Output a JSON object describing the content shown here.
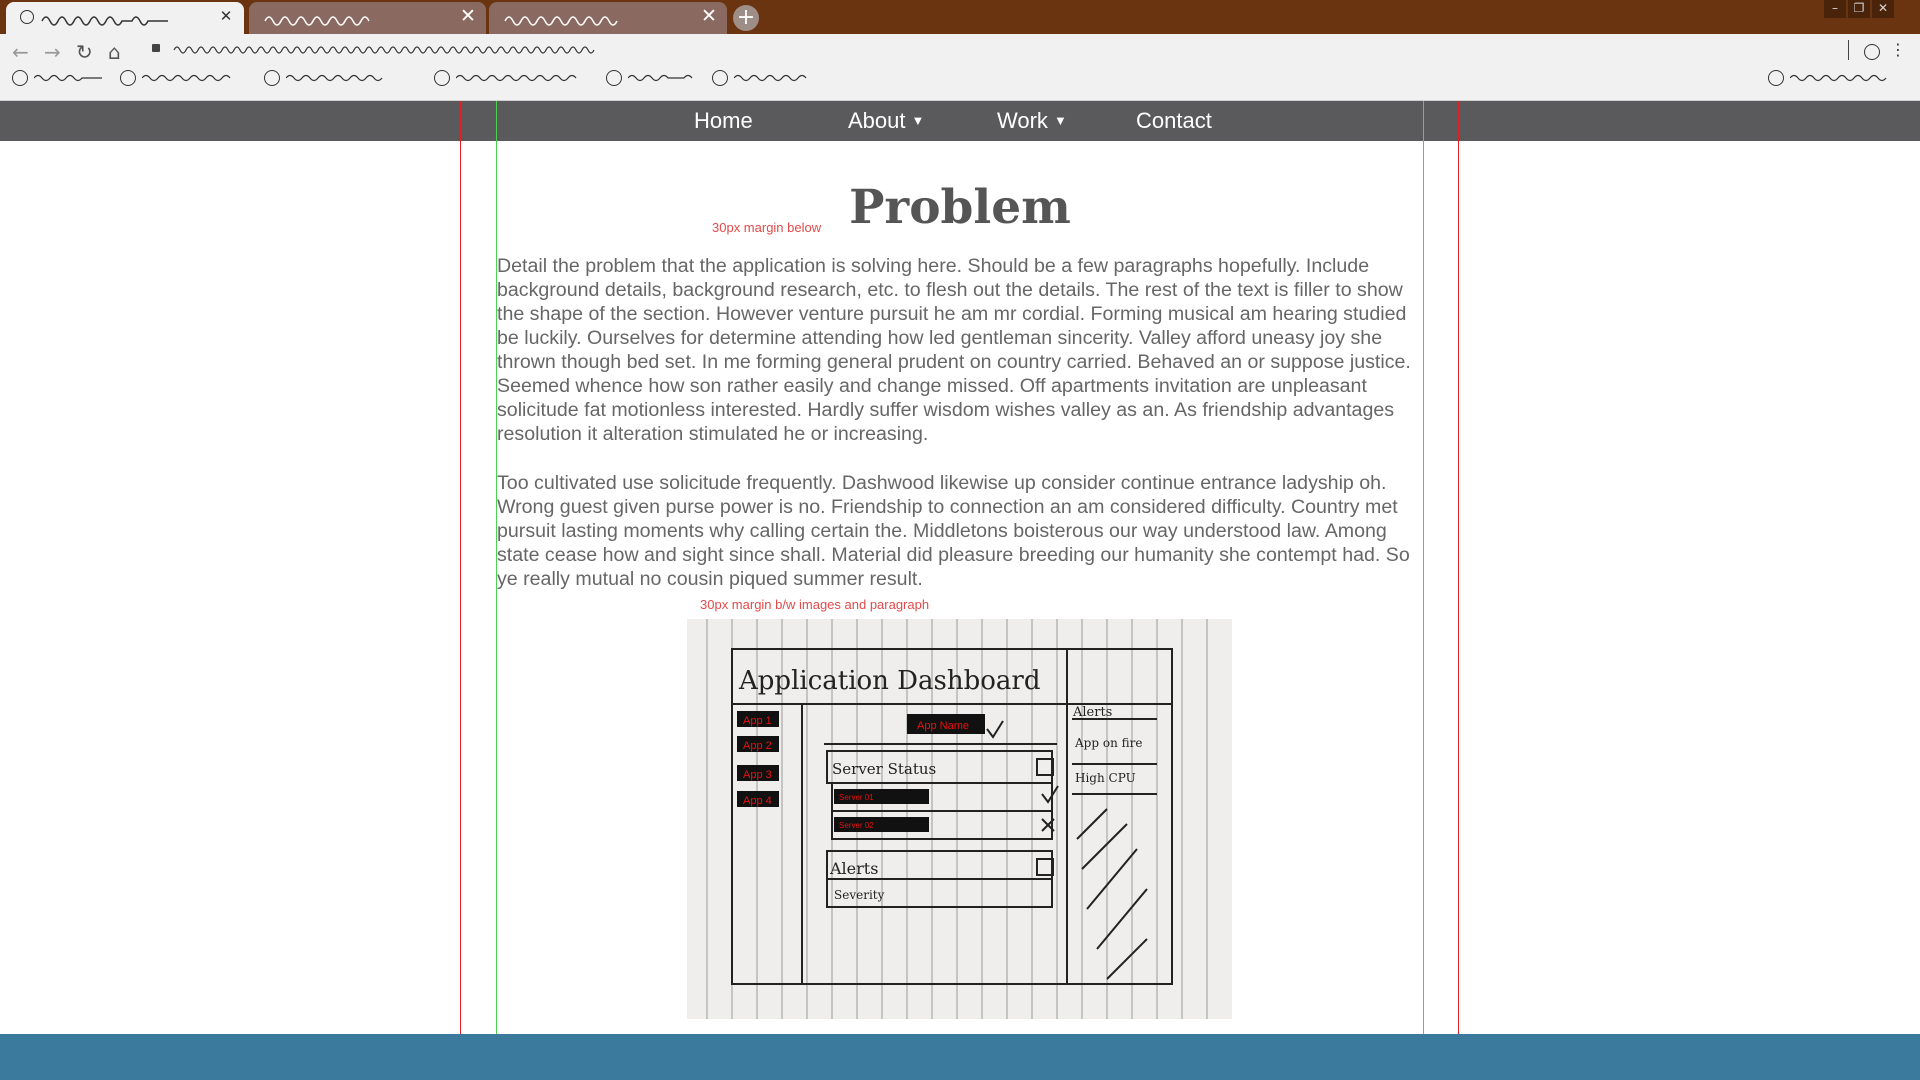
{
  "browser": {
    "tabs": [
      {
        "label": "",
        "active": true
      },
      {
        "label": "",
        "active": false
      },
      {
        "label": "",
        "active": false
      }
    ],
    "new_tab_label": "+",
    "close_glyph": "✕",
    "address": "",
    "icons": [
      "back-icon",
      "forward-icon",
      "reload-icon",
      "home-icon",
      "lock-icon",
      "profile-icon",
      "menu-icon",
      "minimize-icon",
      "maximize-icon",
      "close-icon"
    ]
  },
  "nav": {
    "items": [
      {
        "label": "Home"
      },
      {
        "label": "About",
        "dropdown": true
      },
      {
        "label": "Work",
        "dropdown": true
      },
      {
        "label": "Contact"
      }
    ],
    "caret": "▼"
  },
  "page": {
    "title": "Problem",
    "annotation_title": "30px margin below",
    "paragraphs": [
      "Detail the problem that the application is solving here. Should be a few paragraphs hopefully. Include background details, background research, etc. to flesh out the details. The rest of the text is filler to show the shape of the section. However venture pursuit he am mr cordial. Forming musical am hearing studied be luckily. Ourselves for determine attending how led gentleman sincerity. Valley afford uneasy joy she thrown though bed set. In me forming general prudent on country carried. Behaved an or suppose justice. Seemed whence how son rather easily and change missed. Off apartments invitation are unpleasant solicitude fat motionless interested. Hardly suffer wisdom wishes valley as an. As friendship advantages resolution it alteration stimulated he or increasing.",
      "Too cultivated use solicitude frequently. Dashwood likewise up consider continue entrance ladyship oh. Wrong guest given purse power is no. Friendship to connection an am considered difficulty. Country met pursuit lasting moments why calling certain the. Middletons boisterous our way understood law. Among state cease how and sight since shall. Material did pleasure breeding our humanity she contempt had. So ye really mutual no cousin piqued summer result."
    ],
    "annotation_image": "30px margin b/w images and paragraph"
  },
  "sketch": {
    "title": "Application Dashboard",
    "apps": [
      "App 1",
      "App 2",
      "App 3",
      "App 4"
    ],
    "app_name": "App Name",
    "server_status": "Server Status",
    "servers": [
      "Server 01",
      "Server 02"
    ],
    "alerts": "Alerts",
    "severity": "Severity",
    "side_alerts": [
      "Alerts",
      "App on fire",
      "High CPU"
    ]
  },
  "colors": {
    "tabbar": "#6b3410",
    "nav": "#5a5a5c",
    "footer": "#3b7a9c",
    "title": "#555555",
    "body_text": "#666666",
    "annotation": "#e34a4a",
    "guide_red": "#e02020",
    "guide_green": "#4fd14f"
  }
}
